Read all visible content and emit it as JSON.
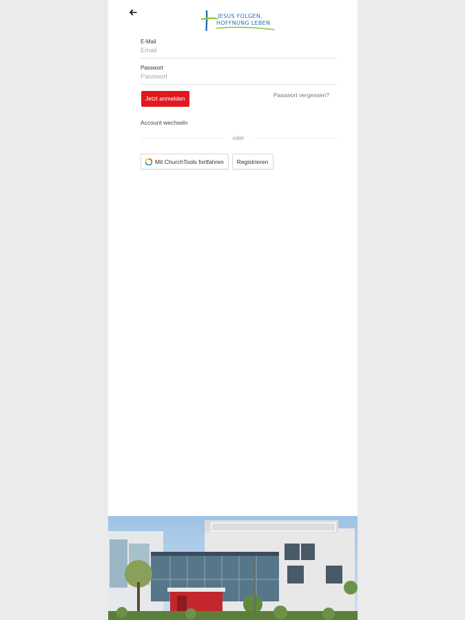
{
  "header": {
    "back_icon": "arrow-left-icon",
    "logo_text_line1": "JESUS FOLGEN,",
    "logo_text_line2": "HOFFNUNG LEBEN"
  },
  "form": {
    "email_label": "E-Mail",
    "email_placeholder": "Email",
    "email_value": "",
    "password_label": "Passwort",
    "password_placeholder": "Passwort",
    "password_value": "",
    "login_button": "Jetzt anmelden",
    "forgot_link": "Passwort vergessen?",
    "switch_account": "Account wechseln",
    "divider_text": "oder",
    "churchtools_button": "Mit ChurchTools fortfahren",
    "register_button": "Registrieren"
  },
  "colors": {
    "accent": "#e0191f",
    "logo_green": "#8dc63f",
    "logo_blue": "#1f6fb5"
  }
}
